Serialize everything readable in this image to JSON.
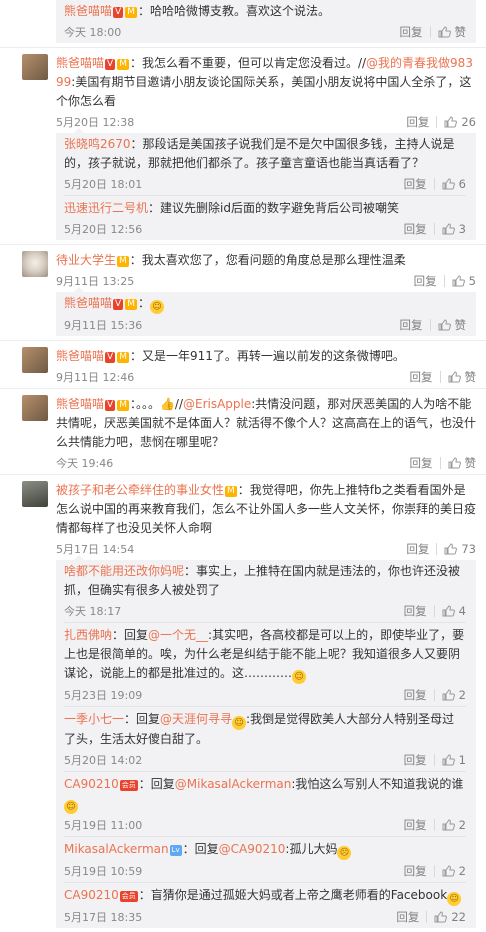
{
  "labels": {
    "reply": "回复",
    "like": "赞"
  },
  "colors": {
    "name": "#eb7350",
    "meta": "#888888",
    "sub_bg": "#f2f2f5"
  },
  "comments": [
    {
      "replies": [
        {
          "name": "熊爸喵喵",
          "badges": [
            "V",
            "M"
          ],
          "text": "：哈哈哈微博支教。喜欢这个说法。",
          "time": "今天 18:00",
          "likes": ""
        }
      ]
    },
    {
      "name": "熊爸喵喵",
      "badges": [
        "V",
        "M"
      ],
      "text_pre": "：我怎么看不重要，但可以肯定您没看过。//",
      "at": "@我的青春我做98399",
      "text_post": ":美国有期节目邀请小朋友谈论国际关系，美国小朋友说将中国人全杀了，这个你怎么看",
      "time": "5月20日 12:38",
      "likes": "26",
      "replies": [
        {
          "name": "张晓鸣2670",
          "text": "：那段话是美国孩子说我们是不是欠中国很多钱，主持人说是的，孩子就说，那就把他们都杀了。孩子童言童语也能当真话看了？",
          "time": "5月20日 18:01",
          "likes": "6"
        },
        {
          "name": "迅速迅行二号机",
          "text": "：建议先删除id后面的数字避免背后公司被嘲笑",
          "time": "5月20日 12:56",
          "likes": "3"
        }
      ]
    },
    {
      "name": "待业大学生",
      "badges": [
        "M"
      ],
      "text_pre": "：我太喜欢您了，您看问题的角度总是那么理性温柔",
      "time": "9月11日 13:25",
      "likes": "5",
      "replies": [
        {
          "name": "熊爸喵喵",
          "badges": [
            "V",
            "M"
          ],
          "text": "：",
          "emoji": true,
          "time": "9月11日 15:36",
          "likes": ""
        }
      ]
    },
    {
      "name": "熊爸喵喵",
      "badges": [
        "V",
        "M"
      ],
      "text_pre": "：又是一年911了。再转一遍以前发的这条微博吧。",
      "time": "9月11日 12:46",
      "likes": ""
    },
    {
      "name": "熊爸喵喵",
      "badges": [
        "V",
        "M"
      ],
      "text_pre": "：。。。👍//",
      "at": "@ErisApple",
      "text_post": ":共情没问题，那对厌恶美国的人为啥不能共情呢，厌恶美国就不是体面人？就活得不像个人？这高高在上的语气，也没什么共情能力吧，悲悯在哪里呢？",
      "time": "今天 19:46",
      "likes": ""
    },
    {
      "name": "被孩子和老公牵绊住的事业女性",
      "badges": [
        "M"
      ],
      "text_pre": "：我觉得吧，你先上推特fb之类看看国外是怎么说中国的再来教育我们，怎么不让外国人多一些人文关怀，你崇拜的美日疫情都每样了也没见关怀人命啊",
      "time": "5月17日 14:54",
      "likes": "73",
      "replies": [
        {
          "name": "啥都不能用还改你妈呢",
          "text": "：事实上，上推特在国内就是违法的，你也许还没被抓，但确实有很多人被处罚了",
          "time": "今天 18:17",
          "likes": "4"
        },
        {
          "name": "扎西佛呐",
          "text": "：回复",
          "at": "@一个无__",
          "text2": ":其实吧，各高校都是可以上的，即使毕业了，要上也是很简单的。唉，为什么老是纠结于能不能上呢？我知道很多人又要阴谋论，说能上的都是批准过的。这…………",
          "emoji_end": true,
          "time": "5月23日 19:09",
          "likes": "2"
        },
        {
          "name": "一季小七一",
          "text": "：回复",
          "at": "@天涯何寻寻",
          "text2": ":我倒是觉得欧美人大部分人特别圣母过了头，生活太好傻白甜了。",
          "emoji_mid": true,
          "time": "5月20日 14:02",
          "likes": "1"
        },
        {
          "name": "CA90210",
          "badges": [
            "R"
          ],
          "text": "：回复",
          "at": "@MikasalAckerman",
          "text2": ":我怕这么写别人不知道我说的谁",
          "emoji_end": true,
          "time": "5月19日 11:00",
          "likes": "2"
        },
        {
          "name": "MikasalAckerman",
          "badges": [
            "B"
          ],
          "text": "：回复",
          "at": "@CA90210",
          "text2": ":孤儿大妈",
          "emoji_end": true,
          "time": "5月19日 10:59",
          "likes": "2"
        },
        {
          "name": "CA90210",
          "badges": [
            "R"
          ],
          "text": "：盲猜你是通过孤姬大妈或者上帝之鹰老师看的Facebook",
          "emoji_end": true,
          "time": "5月17日 18:35",
          "likes": "22"
        }
      ]
    }
  ]
}
